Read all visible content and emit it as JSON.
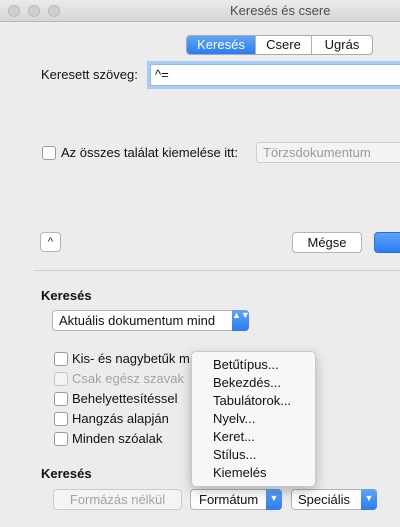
{
  "window": {
    "title": "Keresés és csere"
  },
  "tabs": [
    "Keresés",
    "Csere",
    "Ugrás"
  ],
  "find": {
    "label": "Keresett szöveg:",
    "value": "^="
  },
  "highlight": {
    "label": "Az összes találat kiemelése itt:",
    "select_value": "Törzsdokumentum"
  },
  "buttons": {
    "expand_glyph": "^",
    "cancel": "Mégse"
  },
  "search_section": {
    "title": "Keresés",
    "scope_value": "Aktuális dokumentum mind",
    "options": [
      "Kis- és nagybetűk m",
      "Csak egész szavak",
      "Behelyettesítéssel",
      "Hangzás alapján",
      "Minden szóalak"
    ]
  },
  "format_section": {
    "title": "Keresés",
    "no_format": "Formázás nélkül",
    "format": "Formátum",
    "special": "Speciális"
  },
  "format_menu": [
    "Betűtípus...",
    "Bekezdés...",
    "Tabulátorok...",
    "Nyelv...",
    "Keret...",
    "Stílus...",
    "Kiemelés"
  ],
  "glyphs": {
    "dropdown_updown": "▲▼",
    "dropdown_down": "▼"
  }
}
